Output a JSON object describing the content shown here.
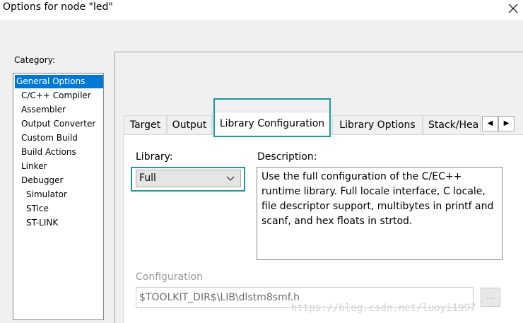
{
  "window": {
    "title": "Options for node \"led\""
  },
  "category": {
    "label": "Category:",
    "items": [
      {
        "label": "General Options"
      },
      {
        "label": "C/C++ Compiler"
      },
      {
        "label": "Assembler"
      },
      {
        "label": "Output Converter"
      },
      {
        "label": "Custom Build"
      },
      {
        "label": "Build Actions"
      },
      {
        "label": "Linker"
      },
      {
        "label": "Debugger"
      },
      {
        "label": "Simulator"
      },
      {
        "label": "STice"
      },
      {
        "label": "ST-LINK"
      }
    ],
    "selected": "General Options"
  },
  "tabs": [
    {
      "label": "Target"
    },
    {
      "label": "Output"
    },
    {
      "label": "Library Configuration"
    },
    {
      "label": "Library Options"
    },
    {
      "label": "Stack/Hea"
    }
  ],
  "active_tab": "Library Configuration",
  "library": {
    "label": "Library:",
    "value": "Full"
  },
  "description": {
    "label": "Description:",
    "text": "Use the full configuration of the C/EC++ runtime library. Full locale interface, C locale, file descriptor support, multibytes in printf and scanf, and hex floats in strtod."
  },
  "configuration": {
    "label": "Configuration",
    "value": "$TOOLKIT_DIR$\\LIB\\dlstm8smf.h",
    "browse_label": "..."
  },
  "watermark": "https://blog.csdn.net/luoyi1997",
  "colors": {
    "selection": "#0078d7",
    "highlight": "#1a9a9a"
  }
}
